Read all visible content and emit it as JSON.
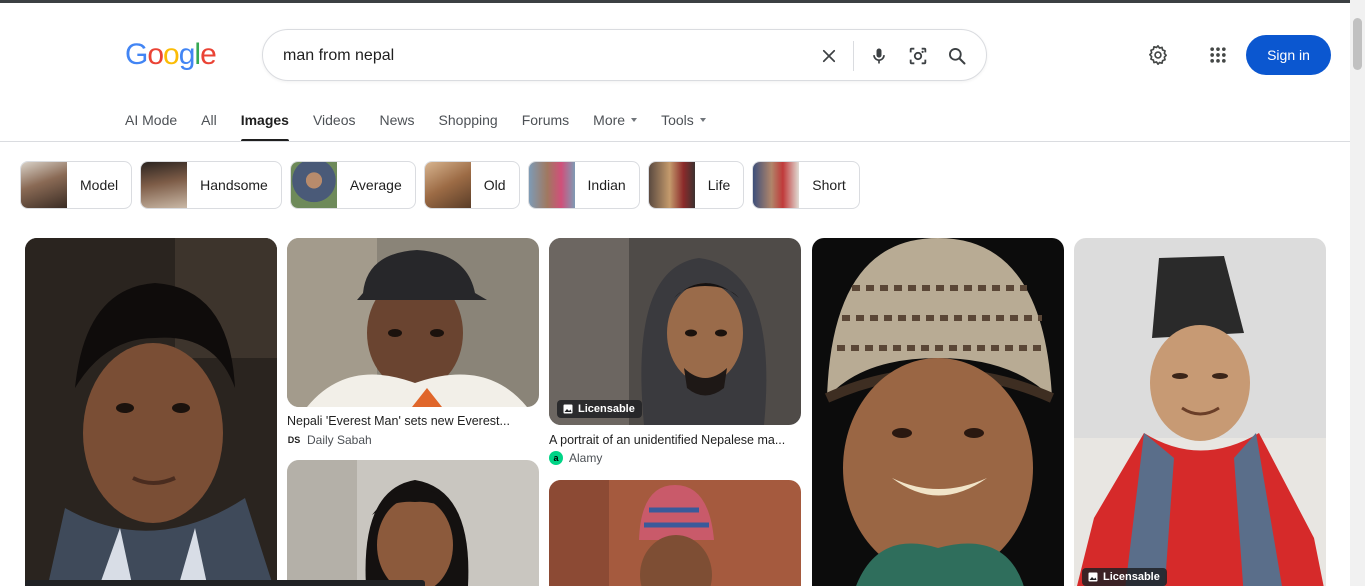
{
  "header": {
    "logo_letters": [
      {
        "ch": "G",
        "color": "#4285F4"
      },
      {
        "ch": "o",
        "color": "#EA4335"
      },
      {
        "ch": "o",
        "color": "#FBBC05"
      },
      {
        "ch": "g",
        "color": "#4285F4"
      },
      {
        "ch": "l",
        "color": "#34A853"
      },
      {
        "ch": "e",
        "color": "#EA4335"
      }
    ],
    "search_value": "man from nepal",
    "sign_in_label": "Sign in"
  },
  "tabs": [
    {
      "label": "AI Mode"
    },
    {
      "label": "All"
    },
    {
      "label": "Images",
      "active": true
    },
    {
      "label": "Videos"
    },
    {
      "label": "News"
    },
    {
      "label": "Shopping"
    },
    {
      "label": "Forums"
    },
    {
      "label": "More",
      "dropdown": true
    },
    {
      "label": "Tools",
      "dropdown": true
    }
  ],
  "chips": [
    {
      "label": "Model"
    },
    {
      "label": "Handsome"
    },
    {
      "label": "Average"
    },
    {
      "label": "Old"
    },
    {
      "label": "Indian"
    },
    {
      "label": "Life"
    },
    {
      "label": "Short"
    }
  ],
  "results": {
    "r2": {
      "caption": "Nepali 'Everest Man' sets new Everest...",
      "source": "Daily Sabah",
      "source_icon": "DS"
    },
    "r3": {
      "caption": "A portrait of an unidentified Nepalese ma...",
      "source": "Alamy",
      "source_icon": "a",
      "badge": "Licensable"
    },
    "r5": {
      "badge": "Licensable"
    }
  },
  "colors": {
    "accent": "#0b57d0",
    "text": "#1f1f1f",
    "muted": "#4d5156",
    "border": "#dadce0"
  }
}
